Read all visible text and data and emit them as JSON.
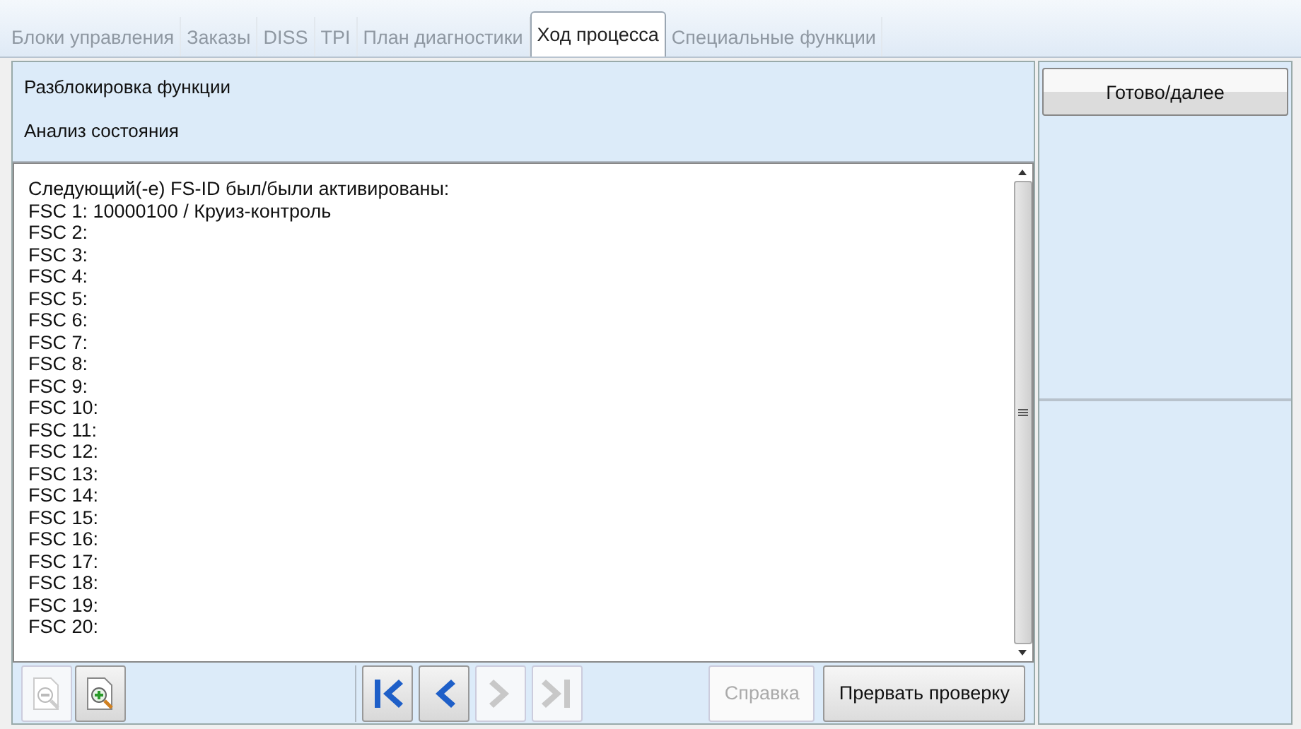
{
  "tabs": [
    {
      "label": "Блоки управления",
      "selected": false,
      "disabled": true
    },
    {
      "label": "Заказы",
      "selected": false,
      "disabled": true
    },
    {
      "label": "DISS",
      "selected": false,
      "disabled": true
    },
    {
      "label": "TPI",
      "selected": false,
      "disabled": true
    },
    {
      "label": "План диагностики",
      "selected": false,
      "disabled": true
    },
    {
      "label": "Ход процесса",
      "selected": true,
      "disabled": false
    },
    {
      "label": "Специальные функции",
      "selected": false,
      "disabled": true
    }
  ],
  "header": {
    "title": "Разблокировка функции",
    "subtitle": "Анализ состояния"
  },
  "log_lines": [
    "Следующий(-е) FS-ID был/были активированы:",
    "FSC 1: 10000100 / Круиз-контроль",
    "FSC 2:",
    "FSC 3:",
    "FSC 4:",
    "FSC 5:",
    "FSC 6:",
    "FSC 7:",
    "FSC 8:",
    "FSC 9:",
    "FSC 10:",
    "FSC 11:",
    "FSC 12:",
    "FSC 13:",
    "FSC 14:",
    "FSC 15:",
    "FSC 16:",
    "FSC 17:",
    "FSC 18:",
    "FSC 19:",
    "FSC 20:"
  ],
  "zoom_tools": [
    {
      "kind": "zoom-out",
      "disabled": true
    },
    {
      "kind": "zoom-in",
      "disabled": false
    }
  ],
  "navigation": [
    {
      "kind": "first",
      "disabled": false
    },
    {
      "kind": "previous",
      "disabled": false
    },
    {
      "kind": "next",
      "disabled": true
    },
    {
      "kind": "last",
      "disabled": true
    }
  ],
  "action_buttons": [
    {
      "label": "Справка",
      "disabled": true
    },
    {
      "label": "Прервать проверку",
      "disabled": false
    }
  ],
  "side_button": {
    "label": "Готово/далее"
  }
}
